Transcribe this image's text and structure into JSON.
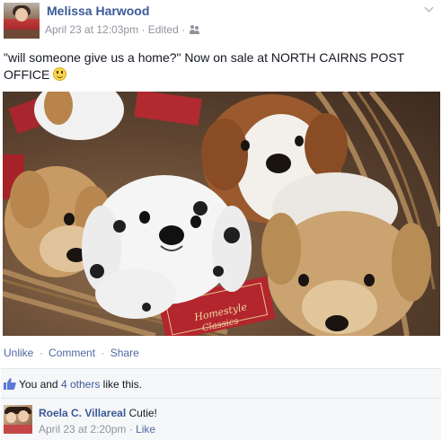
{
  "post": {
    "author": "Melissa Harwood",
    "timestamp": "April 23 at 12:03pm",
    "edited_label": "Edited",
    "separator": "·",
    "privacy_icon": "friends-icon",
    "text": "\"will someone give us a home?\" Now on sale at NORTH CAIRNS POST OFFICE",
    "text_emoji": "smiley-icon"
  },
  "photo": {
    "subject": "plush toy puppies in a wicker basket",
    "tag_text": "Homestyle Classics"
  },
  "actions": {
    "unlike": "Unlike",
    "comment": "Comment",
    "share": "Share",
    "separator": "·"
  },
  "likes": {
    "prefix": "You and ",
    "others_link": "4 others",
    "suffix": " like this."
  },
  "comments": [
    {
      "author": "Roela C. Villareal",
      "text": "Cutie!",
      "timestamp": "April 23 at 2:20pm",
      "separator": "·",
      "like_label": "Like"
    }
  ],
  "colors": {
    "link_blue": "#3b5998",
    "action_blue": "#4e69a2",
    "meta_gray": "#90949c",
    "panel_bg": "#f6f7f9"
  }
}
